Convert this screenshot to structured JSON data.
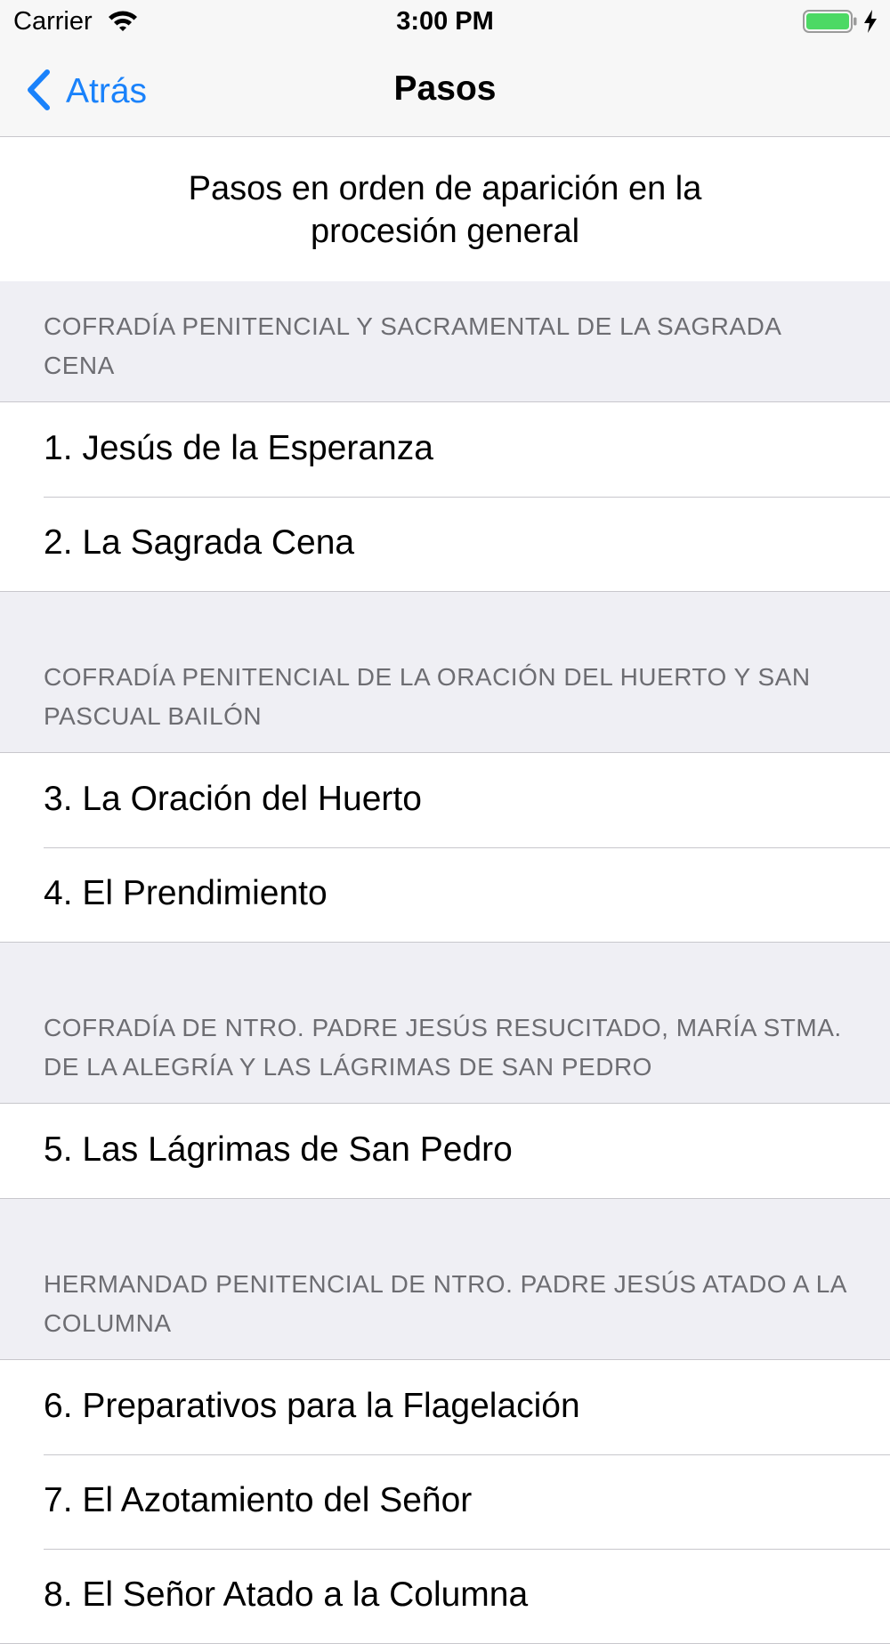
{
  "status_bar": {
    "carrier": "Carrier",
    "time": "3:00 PM",
    "battery_color": "#4cd964"
  },
  "nav": {
    "back_label": "Atrás",
    "title": "Pasos",
    "accent_color": "#1a82fb"
  },
  "intro": {
    "line1": "Pasos en orden de aparición en la",
    "line2": "procesión general"
  },
  "sections": [
    {
      "header": "COFRADÍA PENITENCIAL Y SACRAMENTAL DE LA SAGRADA CENA",
      "rows": [
        "1. Jesús de la Esperanza",
        "2. La Sagrada Cena"
      ]
    },
    {
      "header": "COFRADÍA PENITENCIAL DE LA ORACIÓN DEL HUERTO Y SAN PASCUAL BAILÓN",
      "rows": [
        "3. La Oración del Huerto",
        "4. El Prendimiento"
      ]
    },
    {
      "header": "COFRADÍA DE NTRO. PADRE JESÚS RESUCITADO, MARÍA STMA. DE LA ALEGRÍA Y LAS LÁGRIMAS DE SAN PEDRO",
      "rows": [
        "5. Las Lágrimas de San Pedro"
      ]
    },
    {
      "header": "HERMANDAD PENITENCIAL DE NTRO. PADRE JESÚS ATADO A LA COLUMNA",
      "rows": [
        "6. Preparativos para la Flagelación",
        "7. El Azotamiento del Señor",
        "8. El Señor Atado a la Columna"
      ]
    }
  ]
}
